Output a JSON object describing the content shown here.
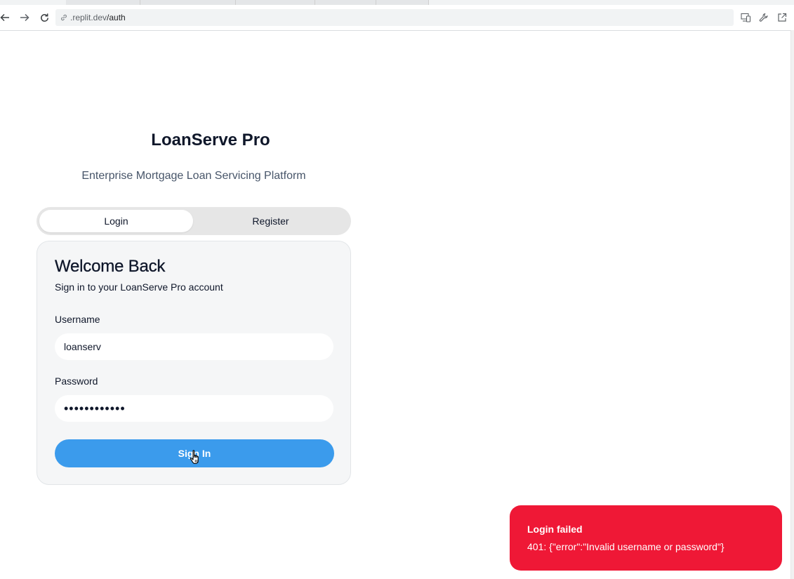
{
  "browser": {
    "url_host": ".replit.dev",
    "url_path": "/auth",
    "icons": [
      "back-arrow-icon",
      "forward-arrow-icon",
      "reload-icon",
      "link-icon",
      "devices-icon",
      "wrench-icon",
      "open-external-icon"
    ]
  },
  "app": {
    "brand": "LoanServe Pro",
    "subtitle": "Enterprise Mortgage Loan Servicing Platform",
    "tabs": [
      {
        "label": "Login",
        "active": true
      },
      {
        "label": "Register",
        "active": false
      }
    ],
    "form": {
      "title": "Welcome Back",
      "description": "Sign in to your LoanServe Pro account",
      "username_label": "Username",
      "username_value": "loanserv",
      "password_label": "Password",
      "password_value": "••••••••••••",
      "submit_label": "Sign In"
    },
    "accent_color": "#3b9bec"
  },
  "toast": {
    "title": "Login failed",
    "message": "401: {\"error\":\"Invalid username or password\"}",
    "color": "#ef1836"
  }
}
